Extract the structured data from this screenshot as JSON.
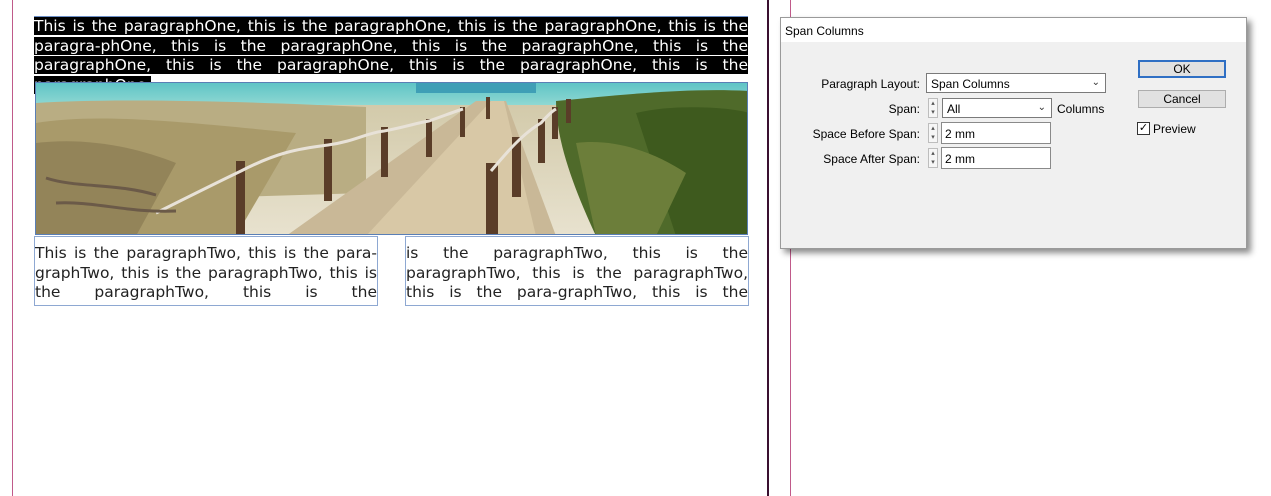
{
  "document": {
    "paragraph_one": "This is the paragraphOne, this is the paragraphOne, this is the paragraphOne, this is the paragra-phOne, this is the paragraphOne, this is the paragraphOne, this is the paragraphOne, this is the paragraphOne, this is the paragraphOne, this is the paragraphOne.",
    "paragraph_two_col1": "This is the paragraphTwo, this is the para-graphTwo, this is the paragraphTwo, this is the paragraphTwo, this is the paragraphTwo, this",
    "paragraph_two_col2": "is the paragraphTwo, this is the paragraphTwo, this is the paragraphTwo, this is the para-graphTwo, this is the paragraphTwo."
  },
  "dialog": {
    "title": "Span Columns",
    "paragraph_layout_label": "Paragraph Layout:",
    "paragraph_layout_value": "Span Columns",
    "span_label": "Span:",
    "span_value": "All",
    "span_unit": "Columns",
    "space_before_label": "Space Before Span:",
    "space_before_value": "2 mm",
    "space_after_label": "Space After Span:",
    "space_after_value": "2 mm",
    "ok_label": "OK",
    "cancel_label": "Cancel",
    "preview_label": "Preview",
    "preview_checked": true
  },
  "colors": {
    "guide": "#c05a8a",
    "frame": "#6c8fc7",
    "dialog_bg": "#f0f0f0",
    "default_button_border": "#2f6fc4"
  }
}
